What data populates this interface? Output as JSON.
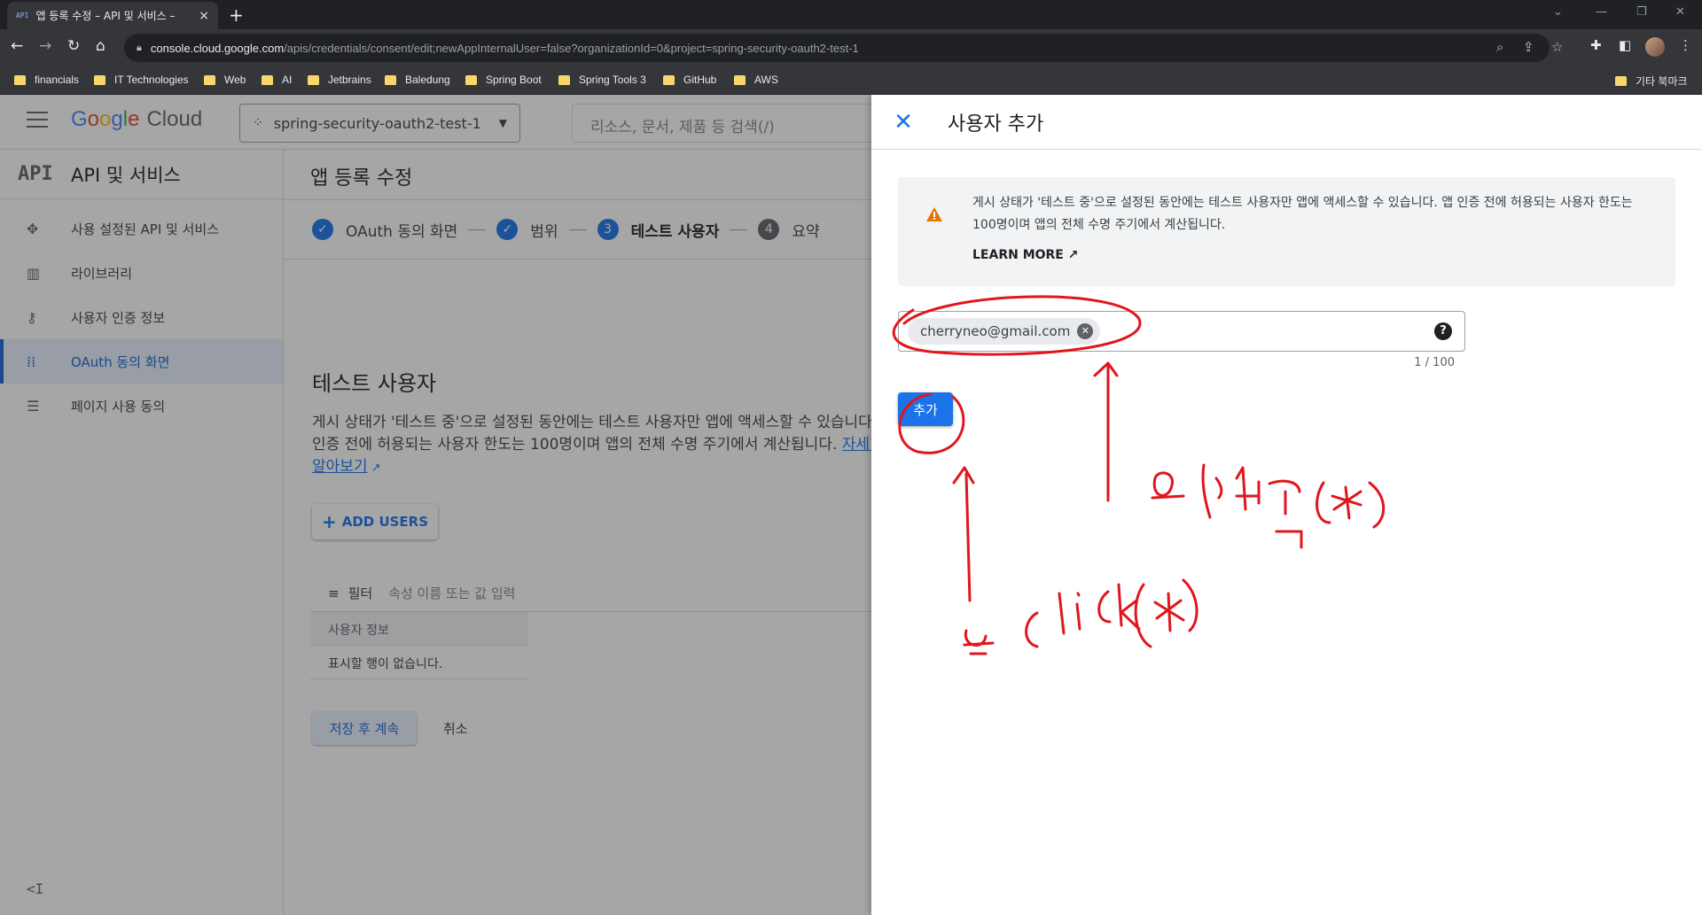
{
  "browser": {
    "tab_favicon": "API",
    "tab_title": "앱 등록 수정 – API 및 서비스 – ",
    "tab_close": "×",
    "new_tab": "+",
    "url_host": "console.cloud.google.com",
    "url_path": "/apis/credentials/consent/edit;newAppInternalUser=false?organizationId=0&project=spring-security-oauth2-test-1",
    "bookmarks": [
      "financials",
      "IT Technologies",
      "Web",
      "AI",
      "Jetbrains",
      "Baledung",
      "Spring Boot",
      "Spring Tools 3",
      "GitHub",
      "AWS"
    ],
    "other_bookmarks": "기타 북마크"
  },
  "console": {
    "logo_google": [
      "G",
      "o",
      "o",
      "g",
      "l",
      "e"
    ],
    "logo_cloud": "Cloud",
    "project_name": "spring-security-oauth2-test-1",
    "search_placeholder": "리소스, 문서, 제품 등 검색(/)"
  },
  "sidebar": {
    "logo": "API",
    "title": "API 및 서비스",
    "items": [
      {
        "label": "사용 설정된 API 및 서비스",
        "icon": "enabled-apis-icon"
      },
      {
        "label": "라이브러리",
        "icon": "library-icon"
      },
      {
        "label": "사용자 인증 정보",
        "icon": "key-icon"
      },
      {
        "label": "OAuth 동의 화면",
        "icon": "consent-icon"
      },
      {
        "label": "페이지 사용 동의",
        "icon": "settings-list-icon"
      }
    ],
    "active_index": 3,
    "collapse": "<I"
  },
  "main": {
    "page_title": "앱 등록 수정",
    "steps": [
      {
        "label": "OAuth 동의 화면",
        "state": "done"
      },
      {
        "label": "범위",
        "state": "done"
      },
      {
        "num": "3",
        "label": "테스트 사용자",
        "state": "current"
      },
      {
        "num": "4",
        "label": "요약",
        "state": "todo"
      }
    ],
    "section_title": "테스트 사용자",
    "description": "게시 상태가 '테스트 중'으로 설정된 동안에는 테스트 사용자만 앱에 액세스할 수 있습니다. 앱 인증 전에 허용되는 사용자 한도는 100명이며 앱의 전체 수명 주기에서 계산됩니다.",
    "learn_more_link": "자세히 알아보기",
    "add_users": "ADD USERS",
    "filter_label": "필터",
    "filter_placeholder": "속성 이름 또는 값 입력",
    "table_header": "사용자 정보",
    "table_empty": "표시할 행이 없습니다.",
    "save_continue": "저장 후 계속",
    "cancel": "취소"
  },
  "drawer": {
    "close": "✕",
    "title": "사용자 추가",
    "banner_text": "게시 상태가 '테스트 중'으로 설정된 동안에는 테스트 사용자만 앱에 액세스할 수 있습니다. 앱 인증 전에 허용되는 사용자 한도는 100명이며 앱의 전체 수명 주기에서 계산됩니다.",
    "learn_more": "LEARN MORE",
    "email_chip": "cherryneo@gmail.com",
    "counter": "1 / 100",
    "add_button": "추가"
  },
  "colors": {
    "accent": "#1a73e8",
    "annotation": "#e0161d",
    "warning": "#e37400"
  }
}
